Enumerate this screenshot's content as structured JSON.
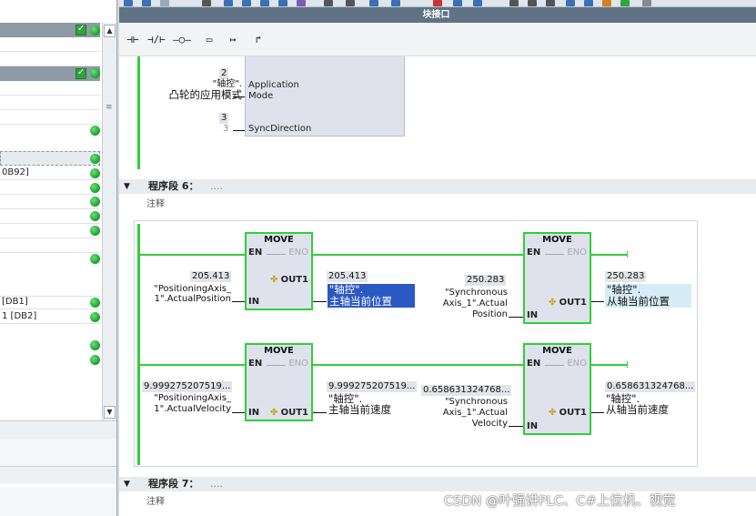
{
  "window": {
    "block_interface_title": "块接口"
  },
  "left_panel": {
    "rows": [
      {
        "text": ""
      },
      {
        "text": ""
      },
      {
        "text": ""
      },
      {
        "text": ""
      },
      {
        "text": ""
      },
      {
        "text": "0B92]"
      },
      {
        "text": ""
      },
      {
        "text": ""
      },
      {
        "text": ""
      },
      {
        "text": ""
      },
      {
        "text": ""
      },
      {
        "text": ""
      },
      {
        "text": "[DB1]"
      },
      {
        "text": "1 [DB2]"
      }
    ]
  },
  "ladder_toolbar": {
    "items": [
      {
        "name": "no-contact",
        "glyph": "⊣⊢"
      },
      {
        "name": "nc-contact",
        "glyph": "⊣/⊢"
      },
      {
        "name": "coil",
        "glyph": "–○–"
      },
      {
        "name": "empty-box",
        "glyph": "▭"
      },
      {
        "name": "open-branch",
        "glyph": "↦"
      },
      {
        "name": "close-branch",
        "glyph": "↱"
      }
    ]
  },
  "network5": {
    "pin_app_value": "2",
    "pin_app_tag_line1": "\"轴控\".",
    "pin_app_tag_line2": "凸轮的应用模式",
    "pin_app_label_line1": "Application",
    "pin_app_label_line2": "Mode",
    "pin_sync_value": "3",
    "pin_sync_value_below": "3",
    "pin_sync_label": "SyncDirection"
  },
  "network6": {
    "title": "程序段 6：",
    "title_dots": "....",
    "comment": "注释",
    "move_box_title": "MOVE",
    "en": "EN",
    "eno": "ENO",
    "in": "IN",
    "out": "OUT1",
    "move1": {
      "in_value": "205.413",
      "in_tag_line1": "\"PositioningAxis_",
      "in_tag_line2": "1\".ActualPosition",
      "out_value": "205.413",
      "out_tag_line1": "\"轴控\".",
      "out_tag_line2": "主轴当前位置"
    },
    "move2": {
      "in_value": "250.283",
      "in_tag_line1": "\"Synchronous",
      "in_tag_line2": "Axis_1\".Actual",
      "in_tag_line3": "Position",
      "out_value": "250.283",
      "out_tag_line1": "\"轴控\".",
      "out_tag_line2": "从轴当前位置"
    },
    "move3": {
      "in_value": "9.999275207519...",
      "in_tag_line1": "\"PositioningAxis_",
      "in_tag_line2": "1\".ActualVelocity",
      "out_value": "9.999275207519...",
      "out_tag_line1": "\"轴控\".",
      "out_tag_line2": "主轴当前速度"
    },
    "move4": {
      "in_value": "0.658631324768...",
      "in_tag_line1": "\"Synchronous",
      "in_tag_line2": "Axis_1\".Actual",
      "in_tag_line3": "Velocity",
      "out_value": "0.658631324768...",
      "out_tag_line1": "\"轴控\".",
      "out_tag_line2": "从轴当前速度"
    }
  },
  "network7": {
    "title": "程序段 7：",
    "title_dots": "....",
    "comment": "注释"
  },
  "watermark": "CSDN @叶强讲PLC、C#上位机、视觉",
  "colors": {
    "rail_green": "#2fcf3a",
    "box_fill": "#dfe2ec",
    "selection_blue": "#2b59c3",
    "header_bar": "#5f7385"
  }
}
